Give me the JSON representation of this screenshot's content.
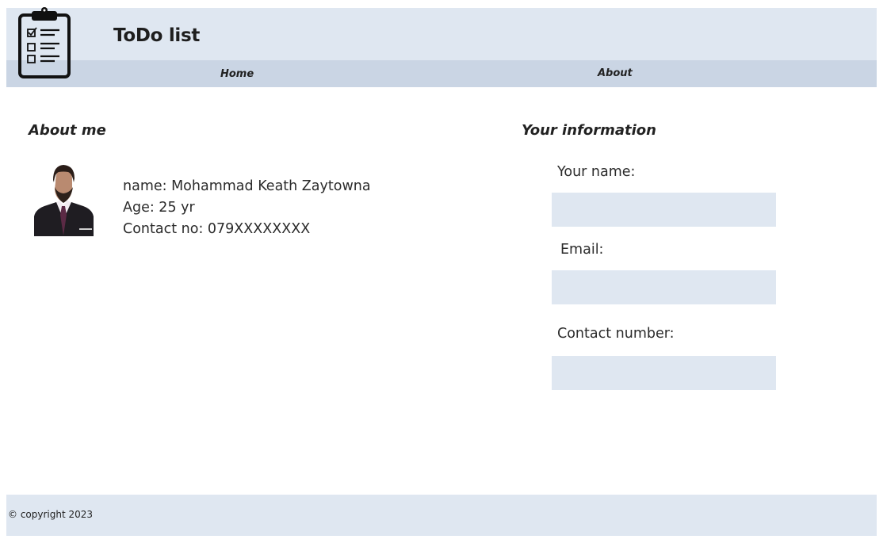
{
  "header": {
    "title": "ToDo list",
    "logo_icon": "clipboard-checklist-icon"
  },
  "nav": {
    "items": [
      {
        "label": "Home"
      },
      {
        "label": "About"
      }
    ]
  },
  "about": {
    "heading": "About me",
    "avatar_icon": "profile-photo",
    "name_line": "name: Mohammad Keath Zaytowna",
    "age_line": "Age: 25 yr",
    "contact_line": "Contact no: 079XXXXXXXX"
  },
  "info_form": {
    "heading": "Your information",
    "fields": [
      {
        "label": "Your name:",
        "value": "",
        "placeholder": ""
      },
      {
        "label": "Email:",
        "value": "",
        "placeholder": ""
      },
      {
        "label": "Contact number:",
        "value": "",
        "placeholder": ""
      }
    ]
  },
  "footer": {
    "text": "© copyright 2023"
  },
  "colors": {
    "header_bg": "#dfe7f1",
    "nav_bg": "#cad5e4",
    "input_bg": "#dfe7f1",
    "footer_bg": "#dfe7f1"
  }
}
